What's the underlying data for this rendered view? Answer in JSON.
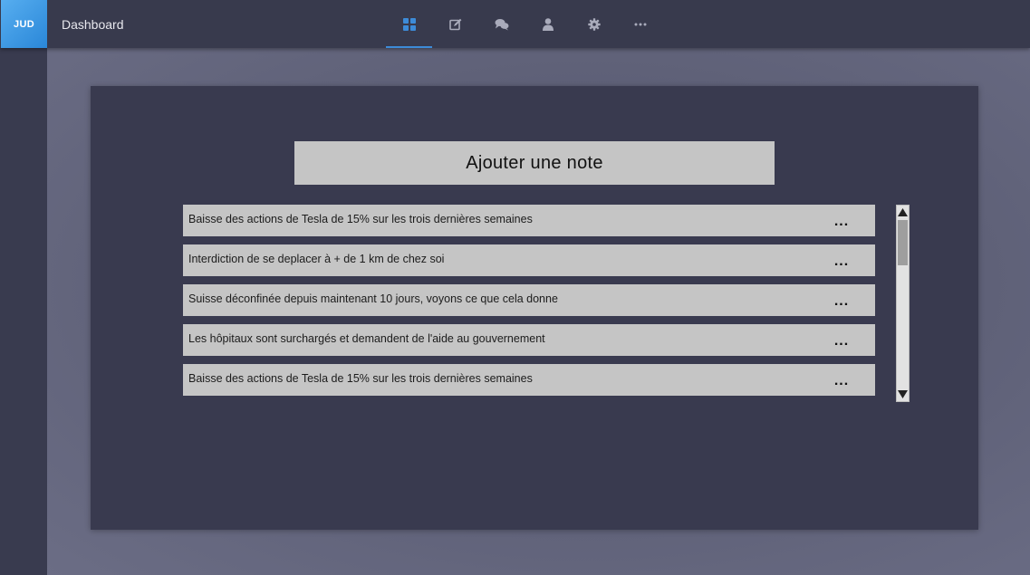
{
  "header": {
    "logo_text": "JUD",
    "title": "Dashboard",
    "nav_icons": [
      "dashboard-grid-icon",
      "edit-icon",
      "chat-icon",
      "user-icon",
      "gear-icon",
      "more-horizontal-icon"
    ],
    "active_nav": "dashboard-grid-icon",
    "accent_color": "#3d8bd8"
  },
  "main": {
    "add_note_label": "Ajouter une note",
    "notes": [
      {
        "text": "Baisse des actions de Tesla de 15% sur les trois dernières semaines",
        "menu": "..."
      },
      {
        "text": "Interdiction de se deplacer à + de 1 km de chez soi",
        "menu": "..."
      },
      {
        "text": " Suisse déconfinée depuis maintenant 10 jours, voyons ce que cela donne",
        "menu": "..."
      },
      {
        "text": "Les hôpitaux sont surchargés et demandent de l'aide au gouvernement",
        "menu": "..."
      },
      {
        "text": "Baisse des actions de Tesla de 15% sur les trois dernières semaines",
        "menu": "..."
      }
    ]
  }
}
